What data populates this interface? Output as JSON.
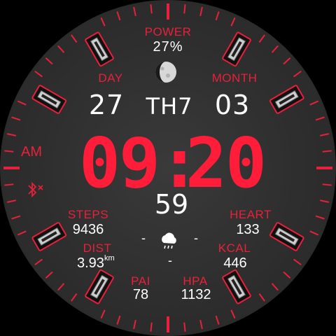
{
  "power": {
    "label": "POWER",
    "value": "27%"
  },
  "date": {
    "day_label": "DAY",
    "day_value": "27",
    "weekday": "TH7",
    "month_label": "MONTH",
    "month_value": "03"
  },
  "time": {
    "ampm": "AM",
    "hours": "09",
    "separator": ":",
    "minutes": "20",
    "seconds": "59"
  },
  "steps": {
    "label": "STEPS",
    "value": "9436"
  },
  "heart": {
    "label": "HEART",
    "value": "133"
  },
  "dist": {
    "label": "DIST",
    "value": "3.93",
    "unit": "km"
  },
  "kcal": {
    "label": "KCAL",
    "value": "446"
  },
  "pai": {
    "label": "PAI",
    "value": "78"
  },
  "hpa": {
    "label": "HPA",
    "value": "1132"
  },
  "weather": {
    "left_temp": "-",
    "right_temp": "-",
    "bottom_text": "-"
  },
  "icons": {
    "moon": "moon-phase-icon",
    "weather": "rain-cloud-icon",
    "bluetooth": "bluetooth-disconnected-icon"
  },
  "colors": {
    "accent": "#e8203a",
    "time": "#ff1d3a",
    "text": "#ffffff",
    "face": "#2e2e2e"
  }
}
